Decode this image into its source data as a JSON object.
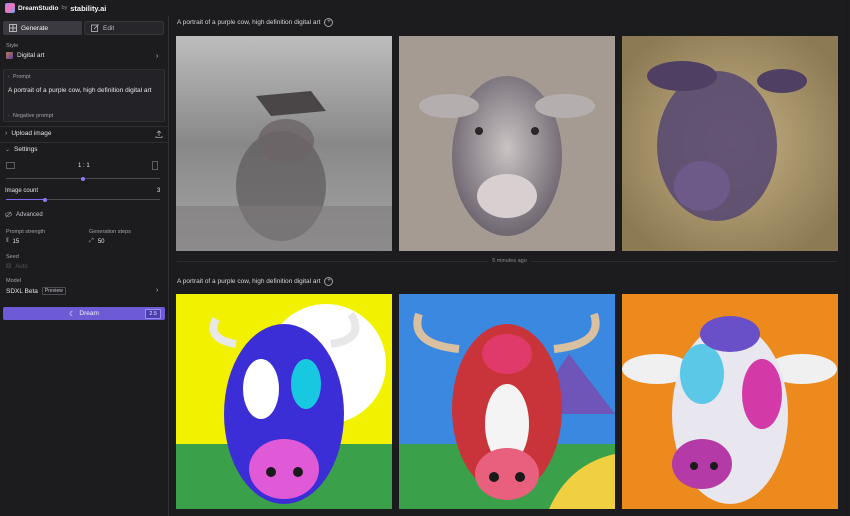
{
  "brand": {
    "name": "DreamStudio",
    "by": "by",
    "company": "stability.ai"
  },
  "tabs": {
    "generate": "Generate",
    "edit": "Edit"
  },
  "style": {
    "label": "Style",
    "value": "Digital art"
  },
  "prompt": {
    "label": "Prompt",
    "text": "A portrait of a purple cow, high definition digital art"
  },
  "negative_prompt": {
    "label": "Negative prompt"
  },
  "upload": {
    "label": "Upload image"
  },
  "settings": {
    "label": "Settings",
    "aspect_ratio": "1 : 1",
    "image_count_label": "Image count",
    "image_count_value": "3",
    "advanced_label": "Advanced",
    "prompt_strength_label": "Prompt strength",
    "prompt_strength_value": "15",
    "generation_steps_label": "Generation steps",
    "generation_steps_value": "50",
    "seed_label": "Seed",
    "seed_value": "Auto",
    "model_label": "Model",
    "model_value": "SDXL Beta",
    "model_badge": "Preview",
    "image_count_fraction": 0.25,
    "aspect_fraction": 0.5
  },
  "dream_button": {
    "label": "Dream",
    "count": "2.5"
  },
  "generations": [
    {
      "prompt": "A portrait of a purple cow, high definition digital art"
    },
    {
      "prompt": "A portrait of a purple cow, high definition digital art"
    }
  ],
  "timestamp": "5 minutes ago",
  "colors": {
    "accent": "#6d5bd6",
    "background": "#1c1c1f"
  }
}
